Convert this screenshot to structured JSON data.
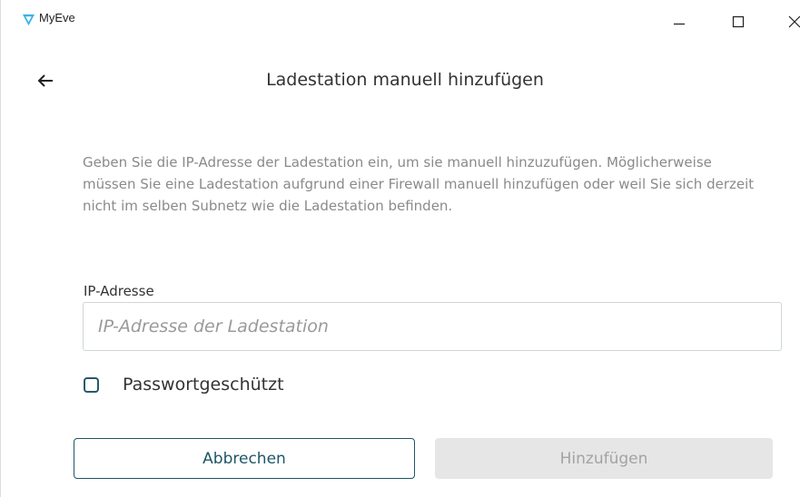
{
  "window": {
    "title": "MyEve",
    "controls": {
      "minimize_icon": "minimize-icon",
      "maximize_icon": "maximize-icon",
      "close_icon": "close-icon"
    }
  },
  "header": {
    "back_icon": "arrow-left-icon",
    "title": "Ladestation manuell hinzufügen"
  },
  "main": {
    "description": "Geben Sie die IP-Adresse der Ladestation ein, um sie manuell hinzuzufügen. Möglicherweise müssen Sie eine Ladestation aufgrund einer Firewall manuell hinzufügen oder weil Sie sich derzeit nicht im selben Subnetz wie die Ladestation befinden.",
    "ip_field": {
      "label": "IP-Adresse",
      "placeholder": "IP-Adresse der Ladestation",
      "value": ""
    },
    "password_checkbox": {
      "label": "Passwortgeschützt",
      "checked": false
    }
  },
  "actions": {
    "cancel_label": "Abbrechen",
    "add_label": "Hinzufügen",
    "add_enabled": false
  },
  "colors": {
    "brand_logo": "#3bb3e6",
    "accent": "#1d5667",
    "disabled_bg": "#e6e6e6",
    "disabled_text": "#a3a3a3",
    "muted_text": "#8a8a8a"
  }
}
